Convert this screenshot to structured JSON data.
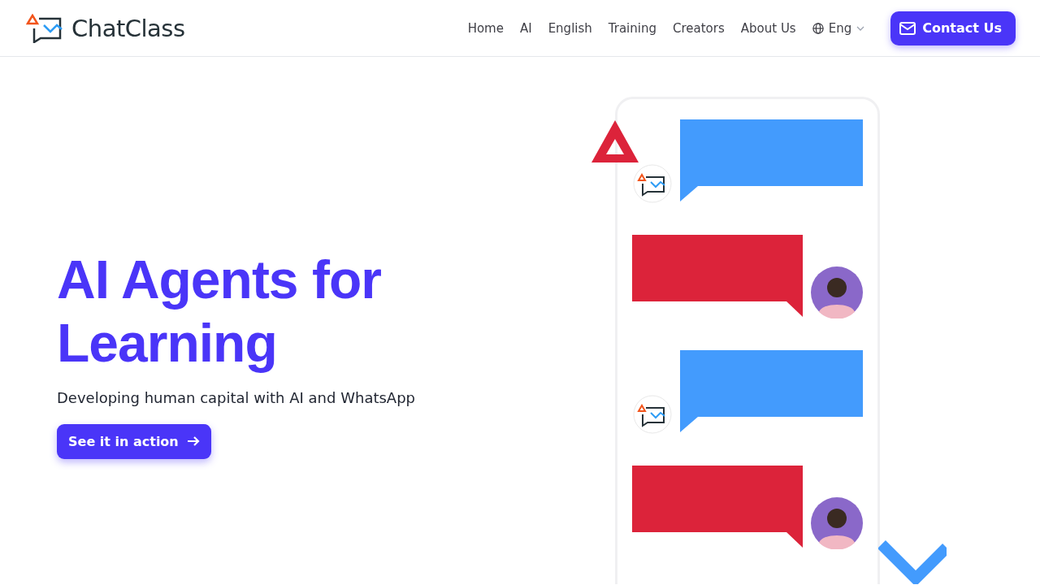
{
  "header": {
    "logo_text": "ChatClass",
    "nav": [
      {
        "label": "Home"
      },
      {
        "label": "AI"
      },
      {
        "label": "English"
      },
      {
        "label": "Training"
      },
      {
        "label": "Creators"
      },
      {
        "label": "About Us"
      }
    ],
    "language": {
      "label": "Eng"
    },
    "contact_button": {
      "label": "Contact Us"
    }
  },
  "hero": {
    "title": "AI Agents for Learning",
    "subtitle": "Developing human capital with AI and WhatsApp",
    "cta": {
      "label": "See it in action"
    }
  },
  "chat": [
    {
      "kind": "bot",
      "color": "#439bfd"
    },
    {
      "kind": "user",
      "color": "#dc233a"
    },
    {
      "kind": "bot",
      "color": "#439bfd"
    },
    {
      "kind": "user",
      "color": "#dc233a"
    }
  ]
}
